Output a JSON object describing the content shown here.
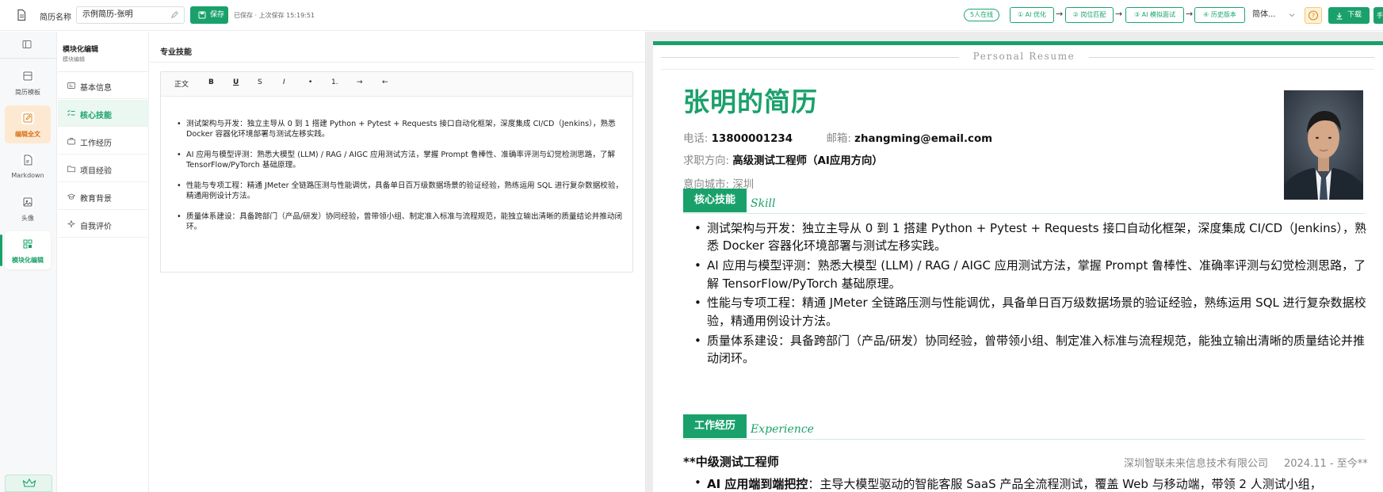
{
  "topbar": {
    "name_label": "简历名称",
    "name_value": "示例简历-张明",
    "save_label": "保存",
    "save_status": "已保存 · 上次保存 15:19:51",
    "online_badge": "5人在线",
    "steps": [
      {
        "label": "① AI 优化"
      },
      {
        "label": "② 岗位匹配"
      },
      {
        "label": "③ AI 模拟面试"
      },
      {
        "label": "④ 历史版本"
      }
    ],
    "language": "简体...",
    "download_label": "下载",
    "more_label": "手机"
  },
  "rail": {
    "items": [
      {
        "label": "简历模板"
      },
      {
        "label": "编辑全文"
      },
      {
        "label": "Markdown"
      },
      {
        "label": "头像"
      },
      {
        "label": "模块化编辑"
      }
    ]
  },
  "modnav": {
    "title": "模块化编辑",
    "subtitle": "模块编辑",
    "items": [
      {
        "label": "基本信息"
      },
      {
        "label": "核心技能"
      },
      {
        "label": "工作经历"
      },
      {
        "label": "项目经验"
      },
      {
        "label": "教育背景"
      },
      {
        "label": "自我评价"
      }
    ]
  },
  "editor": {
    "title": "专业技能",
    "toolbar": [
      "正文",
      "B",
      "U",
      "S",
      "I",
      "•",
      "1.",
      "→",
      "←"
    ],
    "bullets": [
      "测试架构与开发：独立主导从 0 到 1 搭建 Python + Pytest + Requests 接口自动化框架，深度集成 CI/CD（Jenkins），熟悉 Docker 容器化环境部署与测试左移实践。",
      "AI 应用与模型评测：熟悉大模型 (LLM) / RAG / AIGC 应用测试方法，掌握 Prompt 鲁棒性、准确率评测与幻觉检测思路，了解 TensorFlow/PyTorch 基础原理。",
      "性能与专项工程：精通 JMeter 全链路压测与性能调优，具备单日百万级数据场景的验证经验，熟练运用 SQL 进行复杂数据校验，精通用例设计方法。",
      "质量体系建设：具备跨部门（产品/研发）协同经验，曾带领小组、制定准入标准与流程规范，能独立输出清晰的质量结论并推动闭环。"
    ]
  },
  "resume": {
    "header_text": "Personal Resume",
    "name": "张明的简历",
    "phone_label": "电话:",
    "phone": "13800001234",
    "email_label": "邮箱:",
    "email": "zhangming@email.com",
    "target_label": "求职方向:",
    "target": "高级测试工程师（AI应用方向）",
    "city_label": "意向城市:",
    "city": "深圳",
    "skills_tag": "核心技能",
    "skills_en": "Skill",
    "skills": [
      "测试架构与开发：独立主导从 0 到 1 搭建 Python + Pytest + Requests 接口自动化框架，深度集成 CI/CD（Jenkins），熟悉 Docker 容器化环境部署与测试左移实践。",
      "AI 应用与模型评测：熟悉大模型 (LLM) / RAG / AIGC 应用测试方法，掌握 Prompt 鲁棒性、准确率评测与幻觉检测思路，了解 TensorFlow/PyTorch 基础原理。",
      "性能与专项工程：精通 JMeter 全链路压测与性能调优，具备单日百万级数据场景的验证经验，熟练运用 SQL 进行复杂数据校验，精通用例设计方法。",
      "质量体系建设：具备跨部门（产品/研发）协同经验，曾带领小组、制定准入标准与流程规范，能独立输出清晰的质量结论并推动闭环。"
    ],
    "exp_tag": "工作经历",
    "exp_en": "Experience",
    "job_title": "**中级测试工程师",
    "job_company": "深圳智联未来信息技术有限公司",
    "job_date": "2024.11 - 至今**",
    "job_bullet_bold": "AI 应用端到端把控",
    "job_bullet_text": "：主导大模型驱动的智能客服 SaaS 产品全流程测试，覆盖 Web 与移动端，带领 2 人测试小组，"
  },
  "colors": {
    "accent": "#1aa16b",
    "warning_bg": "#fde9d2",
    "help_bg": "#fdf1d8"
  },
  "icons": [
    "document-icon",
    "edit-icon",
    "save-icon",
    "chevron-down-icon",
    "help-icon",
    "download-icon",
    "sidebar-toggle-icon",
    "template-icon",
    "edit-all-icon",
    "markdown-icon",
    "avatar-icon",
    "module-icon",
    "crown-icon"
  ]
}
